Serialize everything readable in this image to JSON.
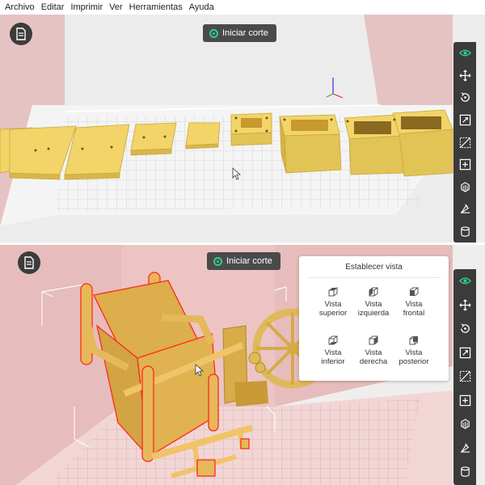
{
  "menubar": {
    "items": [
      "Archivo",
      "Editar",
      "Imprimir",
      "Ver",
      "Herramientas",
      "Ayuda"
    ]
  },
  "top_pane": {
    "slice_button": "Iniciar corte"
  },
  "bottom_pane": {
    "slice_button": "Iniciar corte",
    "view_popup": {
      "title": "Establecer vista",
      "options": [
        {
          "label": "Vista\nsuperior",
          "icon": "cube-top-icon"
        },
        {
          "label": "Vista\nizquierda",
          "icon": "cube-left-icon"
        },
        {
          "label": "Vista\nfrontal",
          "icon": "cube-front-icon"
        },
        {
          "label": "Vista\ninferior",
          "icon": "cube-bottom-icon"
        },
        {
          "label": "Vista\nderecha",
          "icon": "cube-right-icon"
        },
        {
          "label": "Vista\nposterior",
          "icon": "cube-back-icon"
        }
      ]
    }
  },
  "toolbar": {
    "tools": [
      "eye-icon",
      "move-icon",
      "rotate-icon",
      "scale-icon",
      "cut-icon",
      "duplicate-icon",
      "support-icon",
      "measure-icon",
      "layers-icon"
    ]
  },
  "colors": {
    "accent": "#2fcf8a",
    "model": "#f2d469",
    "selection": "#ff2a1a",
    "wall": "#e3b9b9",
    "toolbar": "#3b3b3b"
  }
}
